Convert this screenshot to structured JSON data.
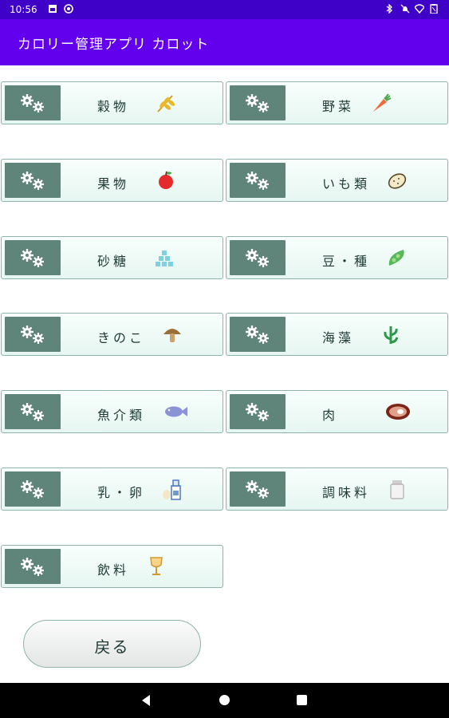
{
  "status_bar": {
    "time": "10:56",
    "left_icons": [
      "image-icon",
      "at-icon"
    ],
    "right_icons": [
      "bluetooth-icon",
      "dnd-off-icon",
      "wifi-icon",
      "battery-icon"
    ]
  },
  "app_bar": {
    "title": "カロリー管理アプリ カロット",
    "color": "#6200ee"
  },
  "categories": [
    {
      "label": "穀物",
      "icon": "wheat-icon"
    },
    {
      "label": "野菜",
      "icon": "carrot-icon"
    },
    {
      "label": "果物",
      "icon": "apple-icon"
    },
    {
      "label": "いも類",
      "icon": "potato-icon"
    },
    {
      "label": "砂糖",
      "icon": "sugar-cubes-icon"
    },
    {
      "label": "豆・種",
      "icon": "bean-pod-icon"
    },
    {
      "label": "きのこ",
      "icon": "mushroom-icon"
    },
    {
      "label": "海藻",
      "icon": "seaweed-icon"
    },
    {
      "label": "魚介類",
      "icon": "fish-icon"
    },
    {
      "label": "肉",
      "icon": "meat-icon"
    },
    {
      "label": "乳・卵",
      "icon": "milk-egg-icon"
    },
    {
      "label": "調味料",
      "icon": "salt-shaker-icon"
    },
    {
      "label": "飲料",
      "icon": "wine-glass-icon"
    }
  ],
  "back_button": {
    "label": "戻る"
  },
  "nav_bar": {
    "icons": [
      "back-triangle-icon",
      "home-circle-icon",
      "recents-square-icon"
    ]
  },
  "colors": {
    "button_border": "#8fb3ad",
    "gear_box": "#5f8479",
    "text": "#1f3a35"
  }
}
